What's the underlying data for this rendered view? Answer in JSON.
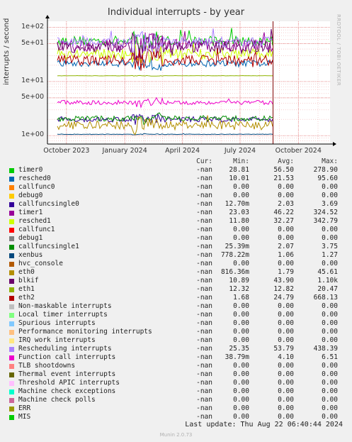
{
  "chart_data": {
    "type": "line",
    "title": "Individual interrupts - by year",
    "ylabel": "interrupts / second",
    "yscale": "log",
    "ylim": [
      0.7,
      130
    ],
    "yticks": [
      {
        "value": 100,
        "label": "1e+02"
      },
      {
        "value": 50,
        "label": "5e+01"
      },
      {
        "value": 10,
        "label": "1e+01"
      },
      {
        "value": 5,
        "label": "5e+00"
      },
      {
        "value": 1,
        "label": "1e+00"
      }
    ],
    "xlim": [
      "2023-09-01",
      "2024-11-20"
    ],
    "xticks": [
      {
        "date": "2023-10-01",
        "label": "October 2023"
      },
      {
        "date": "2024-01-01",
        "label": "January 2024"
      },
      {
        "date": "2024-04-01",
        "label": "April 2024"
      },
      {
        "date": "2024-07-01",
        "label": "July 2024"
      },
      {
        "date": "2024-10-01",
        "label": "October 2024"
      }
    ],
    "now": "2024-08-22",
    "grid": true,
    "columns": [
      "Cur:",
      "Min:",
      "Avg:",
      "Max:"
    ],
    "series": [
      {
        "name": "timer0",
        "color": "#00cc00",
        "cur": "-nan",
        "min": "28.81",
        "avg": "56.50",
        "max": "278.90",
        "level": 56.5,
        "noise": 0.09,
        "plot": true
      },
      {
        "name": "resched0",
        "color": "#0066b3",
        "cur": "-nan",
        "min": "10.01",
        "avg": "21.53",
        "max": "95.60",
        "level": 21.5,
        "noise": 0.06,
        "plot": true
      },
      {
        "name": "callfunc0",
        "color": "#ff8000",
        "cur": "-nan",
        "min": "0.00",
        "avg": "0.00",
        "max": "0.00",
        "level": 0,
        "noise": 0,
        "plot": false
      },
      {
        "name": "debug0",
        "color": "#ffcc00",
        "cur": "-nan",
        "min": "0.00",
        "avg": "0.00",
        "max": "0.00",
        "level": 0,
        "noise": 0,
        "plot": false
      },
      {
        "name": "callfuncsingle0",
        "color": "#330099",
        "cur": "-nan",
        "min": "12.70m",
        "avg": "2.03",
        "max": "3.69",
        "level": 2.0,
        "noise": 0.05,
        "plot": true
      },
      {
        "name": "timer1",
        "color": "#990099",
        "cur": "-nan",
        "min": "23.03",
        "avg": "46.22",
        "max": "324.52",
        "level": 46.2,
        "noise": 0.12,
        "plot": true
      },
      {
        "name": "resched1",
        "color": "#ccff00",
        "cur": "-nan",
        "min": "11.80",
        "avg": "32.27",
        "max": "342.79",
        "level": 32.3,
        "noise": 0.1,
        "plot": true
      },
      {
        "name": "callfunc1",
        "color": "#ff0000",
        "cur": "-nan",
        "min": "0.00",
        "avg": "0.00",
        "max": "0.00",
        "level": 0,
        "noise": 0,
        "plot": false
      },
      {
        "name": "debug1",
        "color": "#808080",
        "cur": "-nan",
        "min": "0.00",
        "avg": "0.00",
        "max": "0.00",
        "level": 0,
        "noise": 0,
        "plot": false
      },
      {
        "name": "callfuncsingle1",
        "color": "#008f00",
        "cur": "-nan",
        "min": "25.39m",
        "avg": "2.07",
        "max": "3.75",
        "level": 2.07,
        "noise": 0.05,
        "plot": true
      },
      {
        "name": "xenbus",
        "color": "#00487d",
        "cur": "-nan",
        "min": "778.22m",
        "avg": "1.06",
        "max": "1.27",
        "level": 1.06,
        "noise": 0.005,
        "plot": true
      },
      {
        "name": "hvc_console",
        "color": "#b35a00",
        "cur": "-nan",
        "min": "0.00",
        "avg": "0.00",
        "max": "0.00",
        "level": 0,
        "noise": 0,
        "plot": false
      },
      {
        "name": "eth0",
        "color": "#b38f00",
        "cur": "-nan",
        "min": "816.36m",
        "avg": "1.79",
        "max": "45.61",
        "level": 1.55,
        "noise": 0.08,
        "plot": true
      },
      {
        "name": "blkif",
        "color": "#6b006b",
        "cur": "-nan",
        "min": "10.89",
        "avg": "43.90",
        "max": "1.10k",
        "level": 43.9,
        "noise": 0.12,
        "plot": true
      },
      {
        "name": "eth1",
        "color": "#8fb300",
        "cur": "-nan",
        "min": "12.32",
        "avg": "12.82",
        "max": "20.47",
        "level": 12.8,
        "noise": 0.003,
        "plot": true
      },
      {
        "name": "eth2",
        "color": "#b30000",
        "cur": "-nan",
        "min": "1.68",
        "avg": "24.79",
        "max": "668.13",
        "level": 24.8,
        "noise": 0.1,
        "plot": true
      },
      {
        "name": "Non-maskable interrupts",
        "color": "#bebebe",
        "cur": "-nan",
        "min": "0.00",
        "avg": "0.00",
        "max": "0.00",
        "level": 0,
        "noise": 0,
        "plot": false
      },
      {
        "name": "Local timer interrupts",
        "color": "#80ff80",
        "cur": "-nan",
        "min": "0.00",
        "avg": "0.00",
        "max": "0.00",
        "level": 0,
        "noise": 0,
        "plot": false
      },
      {
        "name": "Spurious interrupts",
        "color": "#80c9ff",
        "cur": "-nan",
        "min": "0.00",
        "avg": "0.00",
        "max": "0.00",
        "level": 0,
        "noise": 0,
        "plot": false
      },
      {
        "name": "Performance monitoring interrupts",
        "color": "#ffc080",
        "cur": "-nan",
        "min": "0.00",
        "avg": "0.00",
        "max": "0.00",
        "level": 0,
        "noise": 0,
        "plot": false
      },
      {
        "name": "IRQ work interrupts",
        "color": "#ffe680",
        "cur": "-nan",
        "min": "0.00",
        "avg": "0.00",
        "max": "0.00",
        "level": 0,
        "noise": 0,
        "plot": false
      },
      {
        "name": "Rescheduling interrupts",
        "color": "#aa80ff",
        "cur": "-nan",
        "min": "25.35",
        "avg": "53.79",
        "max": "438.39",
        "level": 53.8,
        "noise": 0.09,
        "plot": true
      },
      {
        "name": "Function call interrupts",
        "color": "#ee00cc",
        "cur": "-nan",
        "min": "38.79m",
        "avg": "4.10",
        "max": "6.51",
        "level": 4.1,
        "noise": 0.04,
        "plot": true
      },
      {
        "name": "TLB shootdowns",
        "color": "#ff8080",
        "cur": "-nan",
        "min": "0.00",
        "avg": "0.00",
        "max": "0.00",
        "level": 0,
        "noise": 0,
        "plot": false
      },
      {
        "name": "Thermal event interrupts",
        "color": "#666600",
        "cur": "-nan",
        "min": "0.00",
        "avg": "0.00",
        "max": "0.00",
        "level": 0,
        "noise": 0,
        "plot": false
      },
      {
        "name": "Threshold APIC interrupts",
        "color": "#ffbfff",
        "cur": "-nan",
        "min": "0.00",
        "avg": "0.00",
        "max": "0.00",
        "level": 0,
        "noise": 0,
        "plot": false
      },
      {
        "name": "Machine check exceptions",
        "color": "#00ffcc",
        "cur": "-nan",
        "min": "0.00",
        "avg": "0.00",
        "max": "0.00",
        "level": 0,
        "noise": 0,
        "plot": false
      },
      {
        "name": "Machine check polls",
        "color": "#cc6699",
        "cur": "-nan",
        "min": "0.00",
        "avg": "0.00",
        "max": "0.00",
        "level": 0,
        "noise": 0,
        "plot": false
      },
      {
        "name": "ERR",
        "color": "#999900",
        "cur": "-nan",
        "min": "0.00",
        "avg": "0.00",
        "max": "0.00",
        "level": 0,
        "noise": 0,
        "plot": false
      },
      {
        "name": "MIS",
        "color": "#00cc00",
        "cur": "-nan",
        "min": "0.00",
        "avg": "0.00",
        "max": "0.00",
        "level": 0,
        "noise": 0,
        "plot": false
      }
    ]
  },
  "side_label": "RRDTOOL / TOBI OETIKER",
  "last_update": "Last update: Thu Aug 22 06:40:44 2024",
  "footer": "Munin 2.0.73"
}
